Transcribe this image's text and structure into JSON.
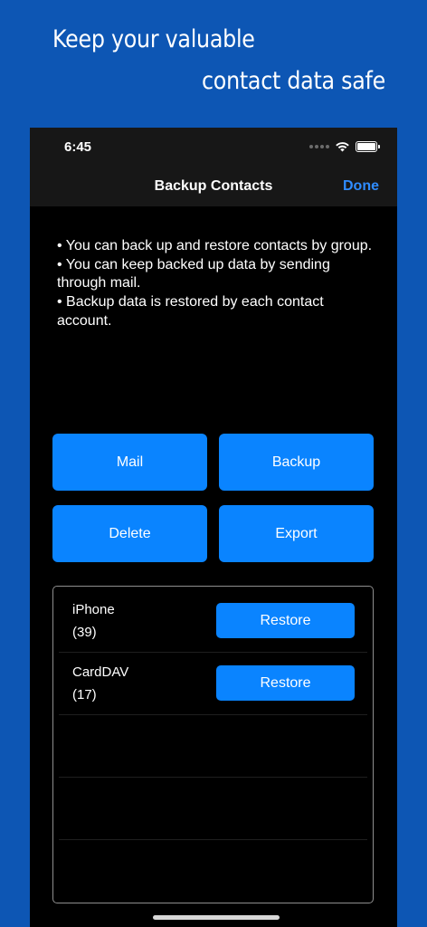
{
  "promo": {
    "line1": "Keep your valuable",
    "line2": "contact data safe",
    "background_color": "#0d56b4"
  },
  "status_bar": {
    "time": "6:45",
    "icons": [
      "signal-dots-icon",
      "wifi-icon",
      "battery-icon"
    ]
  },
  "nav": {
    "title": "Backup Contacts",
    "done_label": "Done",
    "accent_color": "#2f8cff"
  },
  "info": {
    "lines": [
      "• You can back up and restore contacts by group.",
      "• You can keep backed up data by sending through mail.",
      "• Backup data is restored by each contact account."
    ]
  },
  "actions": {
    "mail_label": "Mail",
    "backup_label": "Backup",
    "delete_label": "Delete",
    "export_label": "Export",
    "button_color": "#0a84ff"
  },
  "accounts": [
    {
      "name": "iPhone",
      "count": "(39)",
      "restore_label": "Restore"
    },
    {
      "name": "CardDAV",
      "count": "(17)",
      "restore_label": "Restore"
    }
  ]
}
